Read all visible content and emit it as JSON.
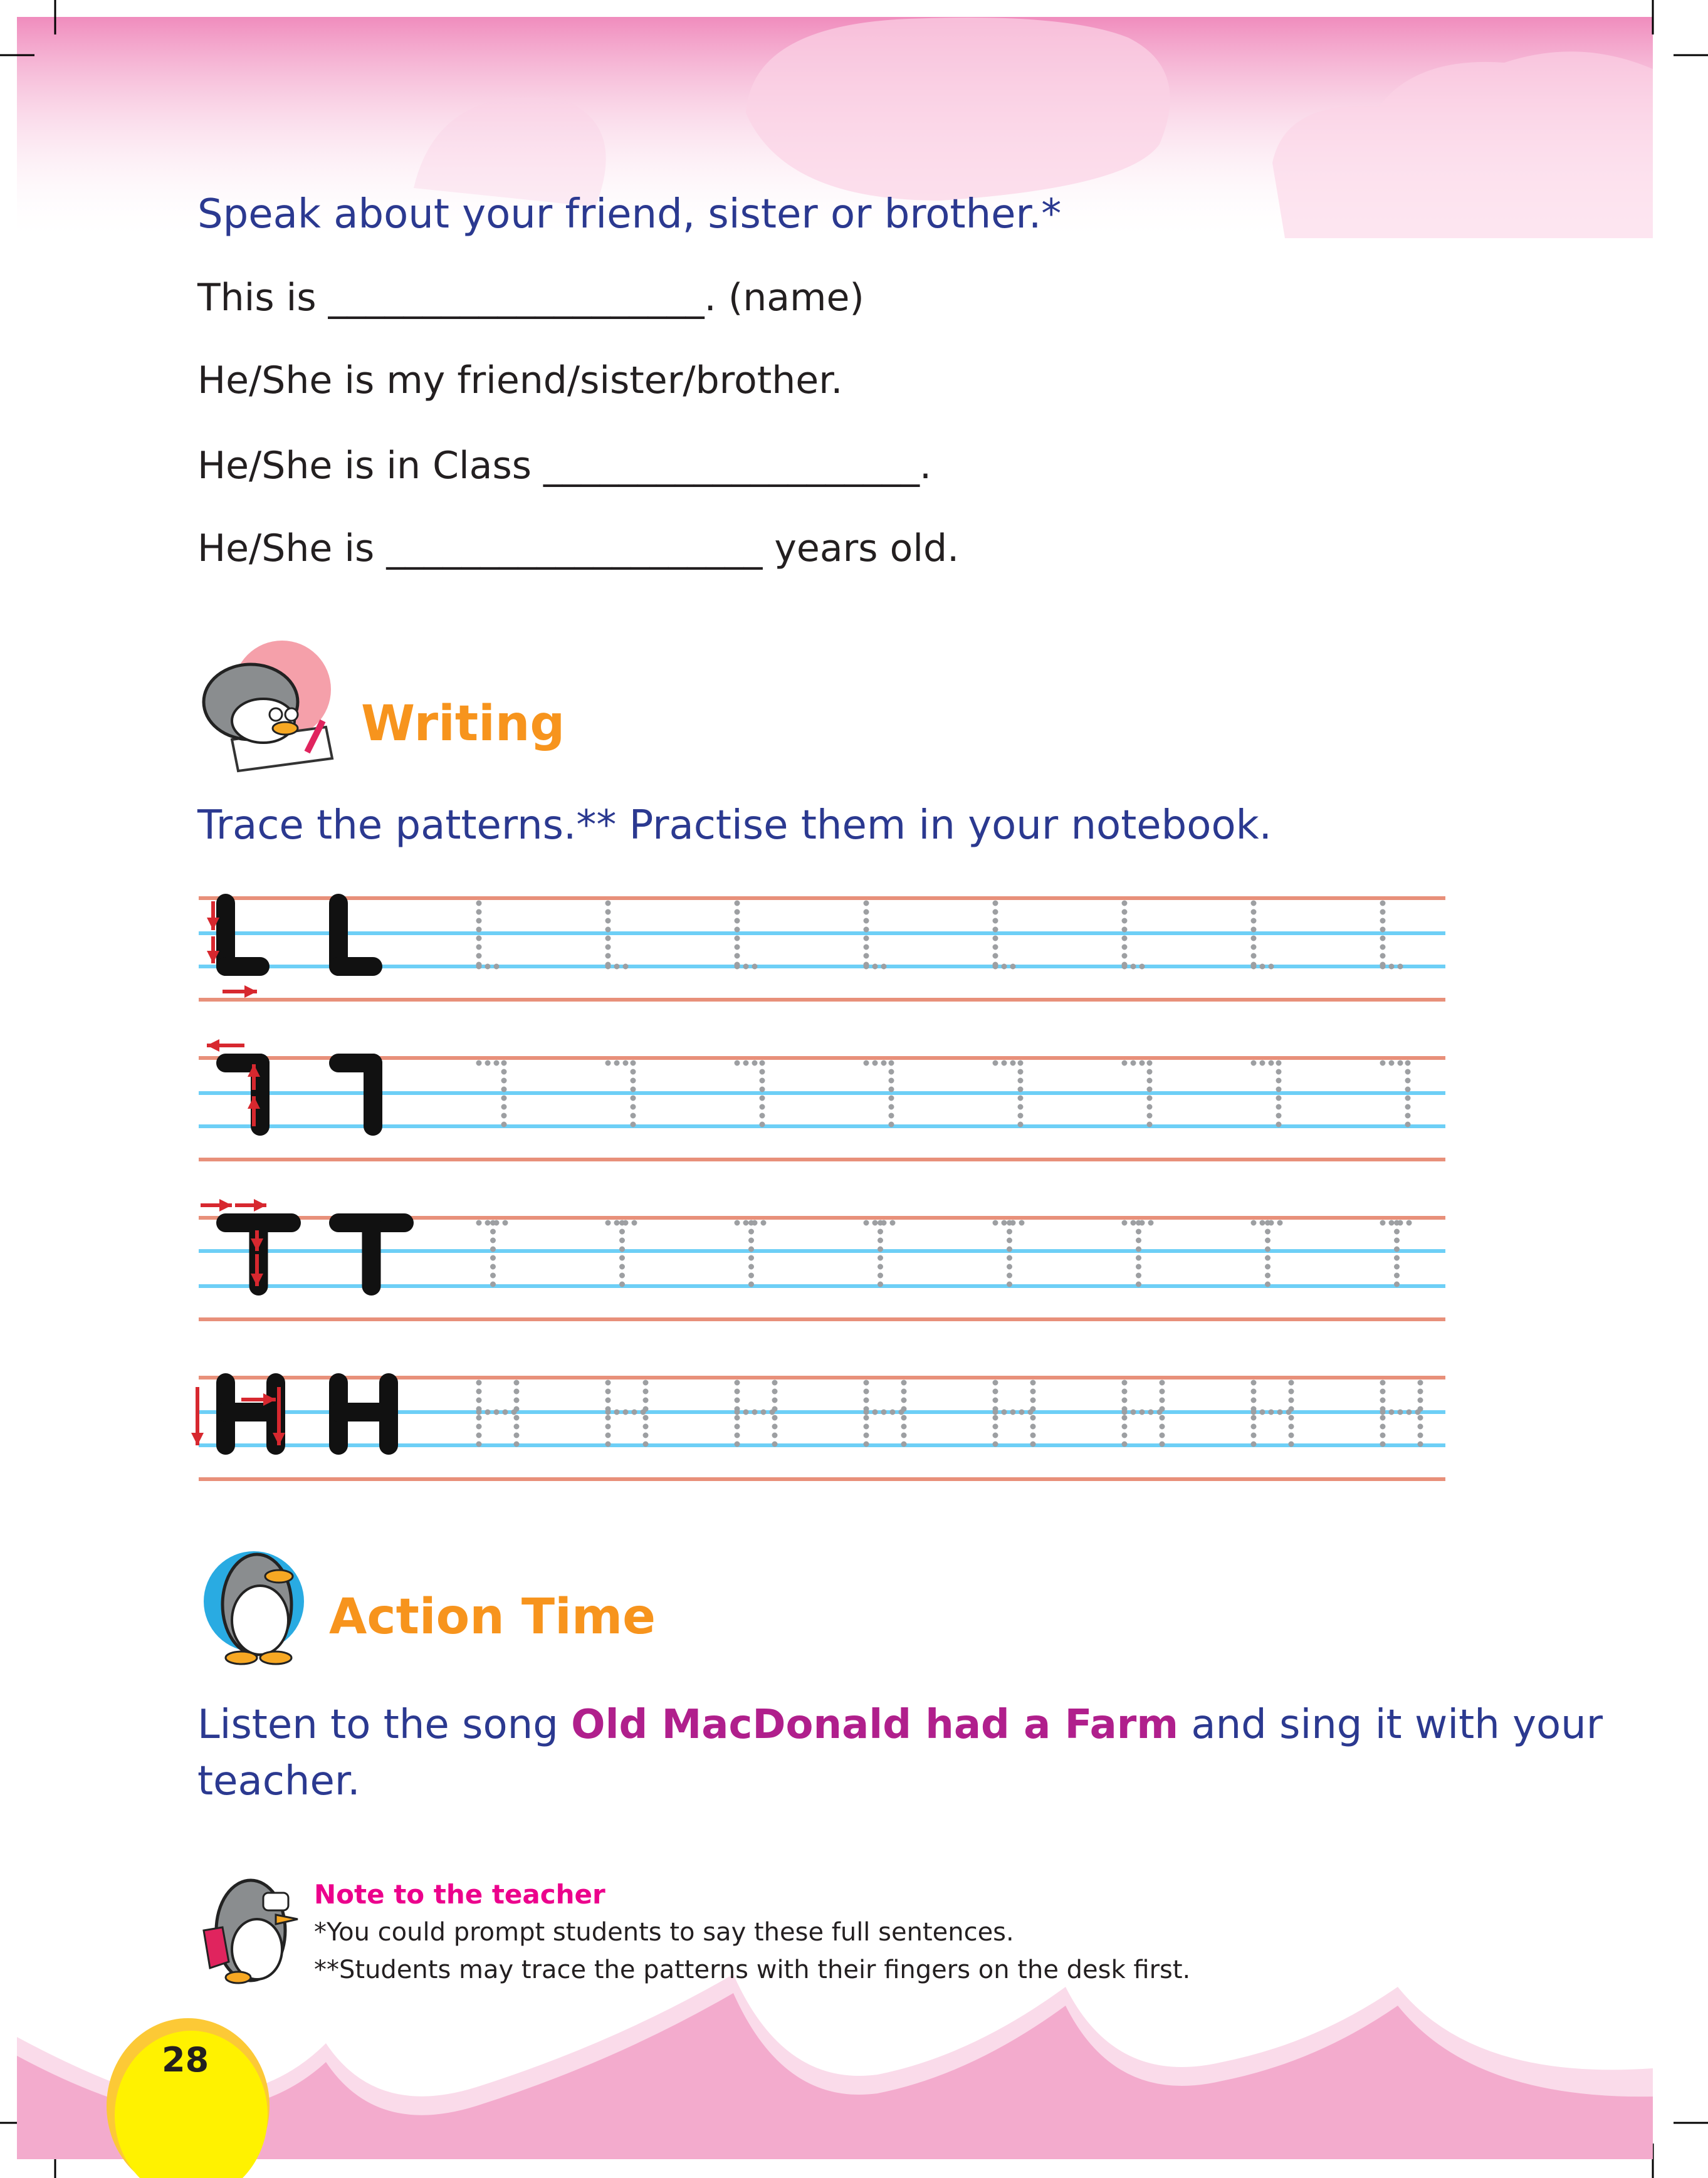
{
  "speaking": {
    "instruction": "Speak about your friend, sister or brother.*",
    "lines": [
      "This is ____________________. (name)",
      "He/She is my friend/sister/brother.",
      "He/She is in Class ____________________.",
      "He/She is ____________________ years old."
    ]
  },
  "writing": {
    "heading": "Writing",
    "icon": "penguin-writing-icon",
    "instruction": "Trace the patterns.** Practise them in your notebook.",
    "patterns": [
      "L",
      "reverse-L",
      "T",
      "H"
    ],
    "trace_count": 8
  },
  "action": {
    "heading": "Action Time",
    "icon": "penguin-action-icon",
    "text_before": "Listen to the song ",
    "song_title": "Old MacDonald had a Farm",
    "text_after": " and sing it with your",
    "text_line2": "teacher."
  },
  "note": {
    "title": "Note to the teacher",
    "icon": "penguin-teacher-icon",
    "lines": [
      "*You could prompt students to say these full sentences.",
      "**Students may trace the patterns with their fingers on the desk first."
    ]
  },
  "page_number": "28",
  "colors": {
    "header_pink": "#f29ac3",
    "footer_pink": "#f3abcd",
    "text_blue": "#2b3990",
    "heading_orange": "#f7941d",
    "song_magenta": "#b01f8c",
    "note_pink": "#ec008c",
    "guide_red_line": "#e8907a",
    "guide_blue_line": "#6dcff6",
    "arrow_red": "#d7282f",
    "page_badge_yellow": "#fff200"
  }
}
